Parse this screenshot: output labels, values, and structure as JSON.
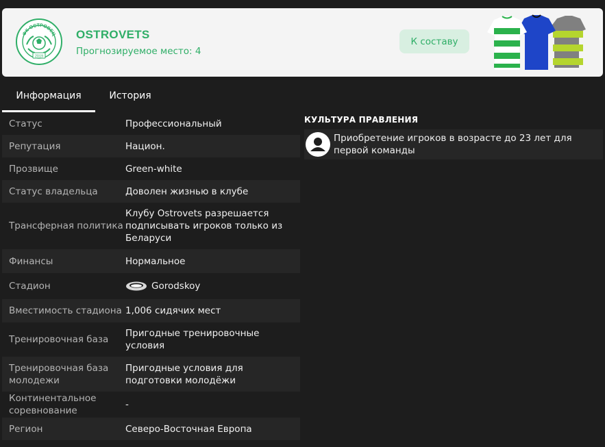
{
  "club": {
    "name": "OSTROVETS",
    "predicted_place": "Прогнозируемое место: 4",
    "crest_text_top": "ФК ОСТРОВЕЦ",
    "crest_year": "2019",
    "squad_button": "К составу"
  },
  "colors": {
    "accent_green": "#2fae67",
    "kit_green": "#2bb24c",
    "kit_blue": "#1e45c8",
    "kit_lime": "#b5d52e",
    "kit_grey": "#808080"
  },
  "tabs": [
    {
      "label": "Информация",
      "active": true
    },
    {
      "label": "История",
      "active": false
    }
  ],
  "info_rows": [
    {
      "label": "Статус",
      "value": "Профессиональный"
    },
    {
      "label": "Репутация",
      "value": "Национ."
    },
    {
      "label": "Прозвище",
      "value": "Green-white"
    },
    {
      "label": "Статус владельца",
      "value": "Доволен жизнью в клубе"
    },
    {
      "label": "Трансферная политика",
      "value": "Клубу Ostrovets разрешается подписывать игроков только из Беларуси"
    },
    {
      "label": "Финансы",
      "value": "Нормальное"
    },
    {
      "label": "Стадион",
      "value": "Gorodskoy",
      "icon": "stadium-icon"
    },
    {
      "label": "Вместимость стадиона",
      "value": "1,006 сидячих мест"
    },
    {
      "label": "Тренировочная база",
      "value": "Пригодные тренировочные условия"
    },
    {
      "label": "Тренировочная база молодежи",
      "value": "Пригодные условия для подготовки молодёжи"
    },
    {
      "label": "Континентальное соревнование",
      "value": "-"
    },
    {
      "label": "Регион",
      "value": "Северо-Восточная Европа"
    }
  ],
  "culture": {
    "title": "КУЛЬТУРА ПРАВЛЕНИЯ",
    "items": [
      {
        "text": "Приобретение игроков в возрасте до 23 лет для первой команды",
        "icon": "person-icon"
      }
    ]
  }
}
